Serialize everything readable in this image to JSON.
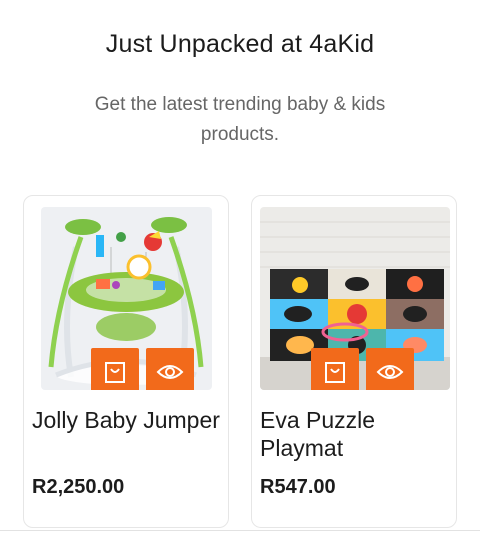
{
  "section": {
    "title": "Just Unpacked at 4aKid",
    "subtitle": "Get the latest trending baby & kids products."
  },
  "products": [
    {
      "name": "Jolly Baby Jumper",
      "price": "R2,250.00",
      "image": "baby-jumper-photo",
      "actions": [
        "shopping-bag-icon",
        "eye-icon"
      ]
    },
    {
      "name": "Eva Puzzle Playmat",
      "price": "R547.00",
      "image": "puzzle-playmat-photo",
      "actions": [
        "shopping-bag-icon",
        "eye-icon"
      ]
    }
  ],
  "colors": {
    "accent": "#f26a1b",
    "title": "#1c1c1c",
    "subtitle": "#666666",
    "card_border": "#e6e6e6"
  }
}
